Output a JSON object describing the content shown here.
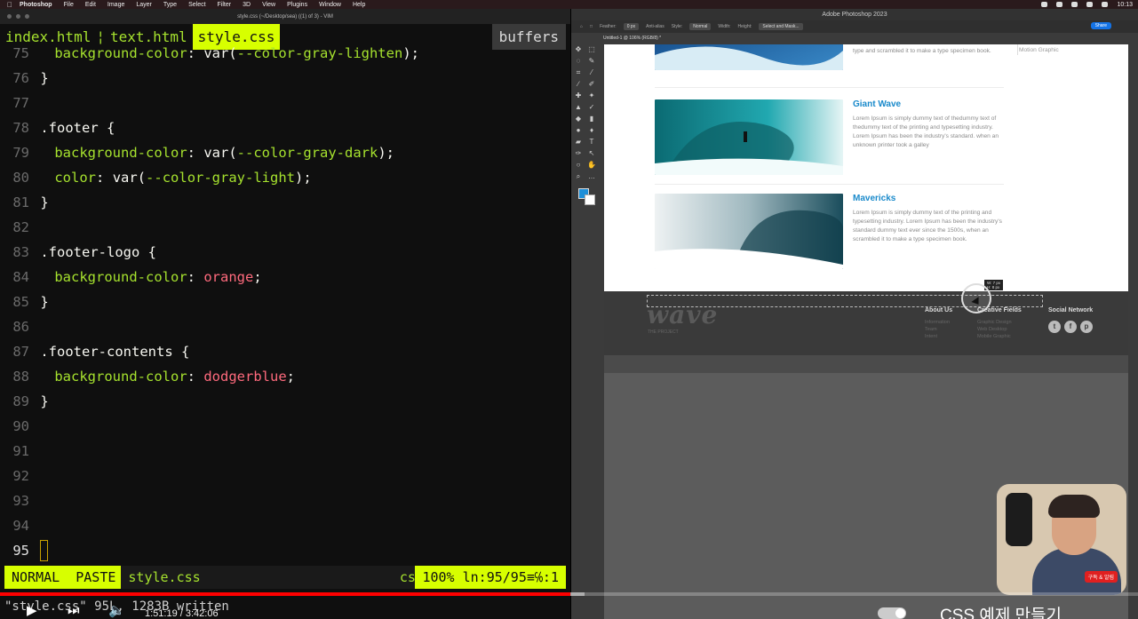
{
  "menubar": {
    "app_name": "Photoshop",
    "items": [
      "File",
      "Edit",
      "Image",
      "Layer",
      "Type",
      "Select",
      "Filter",
      "3D",
      "View",
      "Plugins",
      "Window",
      "Help"
    ],
    "clock": "10:13"
  },
  "vim": {
    "window_title": "style.css (~/Desktop/sea) ((1) of 3) - VIM",
    "tabs": [
      {
        "label": "index.html",
        "active": false
      },
      {
        "label": "text.html",
        "active": false
      },
      {
        "label": "style.css",
        "active": true
      }
    ],
    "tab_separator": "¦",
    "buffers_label": "buffers",
    "lines": {
      "l75": {
        "num": "75",
        "prop": "background-color",
        "fn": "var",
        "arg": "--color-gray-lighten"
      },
      "l76": {
        "num": "76",
        "text": "}"
      },
      "l77": {
        "num": "77"
      },
      "l78": {
        "num": "78",
        "selector": ".footer {"
      },
      "l79": {
        "num": "79",
        "prop": "background-color",
        "fn": "var",
        "arg": "--color-gray-dark"
      },
      "l80": {
        "num": "80",
        "prop": "color",
        "fn": "var",
        "arg": "--color-gray-light"
      },
      "l81": {
        "num": "81",
        "text": "}"
      },
      "l82": {
        "num": "82"
      },
      "l83": {
        "num": "83",
        "selector": ".footer-logo {"
      },
      "l84": {
        "num": "84",
        "prop": "background-color",
        "value": "orange"
      },
      "l85": {
        "num": "85",
        "text": "}"
      },
      "l86": {
        "num": "86"
      },
      "l87": {
        "num": "87",
        "selector": ".footer-contents {"
      },
      "l88": {
        "num": "88",
        "prop": "background-color",
        "value": "dodgerblue"
      },
      "l89": {
        "num": "89",
        "text": "}"
      },
      "l90": {
        "num": "90"
      },
      "l91": {
        "num": "91"
      },
      "l92": {
        "num": "92"
      },
      "l93": {
        "num": "93"
      },
      "l94": {
        "num": "94"
      },
      "l95": {
        "num": "95"
      }
    },
    "status": {
      "mode": "NORMAL",
      "paste": "PASTE",
      "filename": "style.css",
      "filetype": "css",
      "position": "100%  ln:95/95≡℅:1"
    },
    "cmdline": "\"style.css\" 95L, 1283B written"
  },
  "photoshop": {
    "app_title": "Adobe Photoshop 2023",
    "doc_tab": "Untitled-1 @ 106% (RGB/8) *",
    "options": {
      "feather_label": "Feather:",
      "feather_value": "0 px",
      "anti_alias": "Anti-alias",
      "style_label": "Style:",
      "style_value": "Normal",
      "width_label": "Width:",
      "height_label": "Height:",
      "mask_button": "Select and Mask...",
      "share_button": "Share"
    },
    "canvas": {
      "top_snippet": "type and scrambled it to make a type specimen book.",
      "side_hint": "Motion Graphic",
      "articles": [
        {
          "title": "Giant Wave",
          "body": "Lorem Ipsum is simply dummy text of thedummy text of thedummy text of the printing and typesetting industry. Lorem Ipsum has been the industry's standard. when an unknown printer took a galley"
        },
        {
          "title": "Mavericks",
          "body": "Lorem Ipsum is simply dummy text of the printing and typesetting industry. Lorem Ipsum has been the industry's standard dummy text ever since the 1500s, when an scrambled it to make a type specimen book."
        }
      ],
      "footer": {
        "logo": "wave",
        "tagline": "THE PROJECT",
        "about_title": "About Us",
        "about_items": [
          "Information",
          "Team",
          "Intent"
        ],
        "fields_title": "Creative Fields",
        "fields_items": [
          "Graphic Design",
          "Web Desktop",
          "Mobile Graphic"
        ],
        "social_title": "Social Network",
        "social_icons": [
          "twitter-icon",
          "facebook-icon",
          "pinterest-icon"
        ]
      },
      "measure_readout": "W: 7 px\nH: 8 px"
    }
  },
  "webcam": {
    "badge": "구독 & 알림"
  },
  "player": {
    "time": "1:51:19 / 3:42:06",
    "video_title": "CSS 예제 만들기",
    "played_fraction": 0.501,
    "loaded_fraction": 0.514
  },
  "colors": {
    "vim_accent": "#d7ff00",
    "vim_green": "#a6e22e",
    "vim_keyword": "#ff6a7d",
    "ps_link_blue": "#1a8acb",
    "progress_red": "#ff0000"
  }
}
